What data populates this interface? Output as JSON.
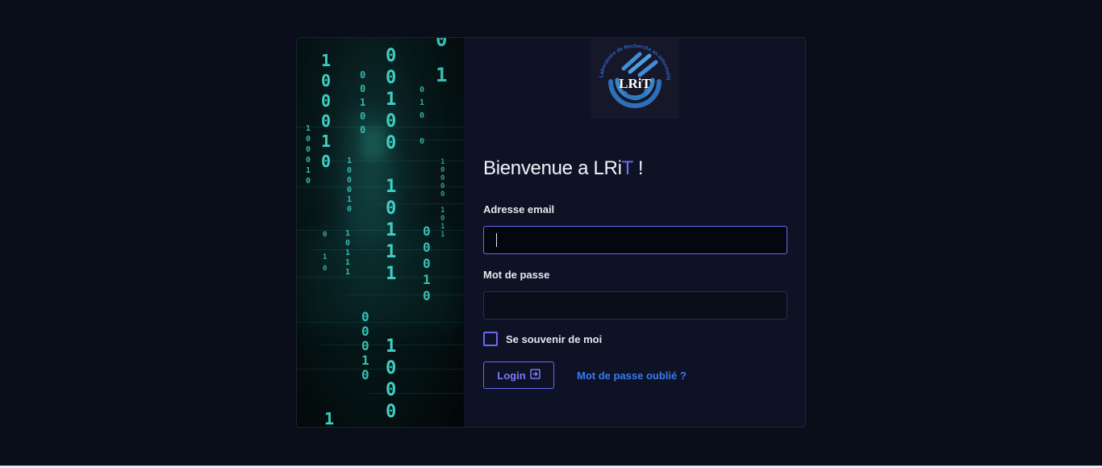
{
  "welcome": {
    "prefix": "Bienvenue a LRi",
    "accent": "T",
    "suffix": " !"
  },
  "logo": {
    "text": "LRiT",
    "ring_text": "Laboratoire de Recherche en Informatique Tlemcen"
  },
  "email": {
    "label": "Adresse email",
    "value": "",
    "placeholder": ""
  },
  "password": {
    "label": "Mot de passe",
    "value": "",
    "placeholder": ""
  },
  "remember": {
    "label": "Se souvenir de moi",
    "checked": false
  },
  "login": {
    "label": "Login",
    "icon": "login-enter-icon"
  },
  "forgot": {
    "label": "Mot de passe oublié ?"
  },
  "colors": {
    "accent": "#6a67f0",
    "link": "#3a7bf0",
    "background": "#0a0e1a",
    "card": "#0d1325",
    "matrix": "#3ed0c4"
  }
}
